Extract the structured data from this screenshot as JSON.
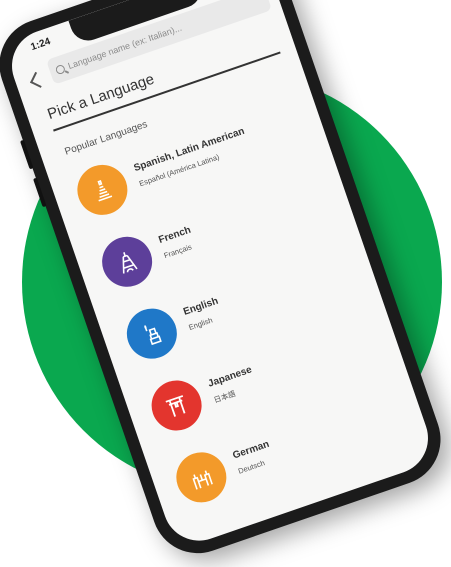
{
  "status_bar": {
    "time": "1:24",
    "icons": "▮▮▮ ◠ ▭"
  },
  "search": {
    "placeholder": "Language name (ex: Italian)..."
  },
  "page": {
    "title": "Pick a Language",
    "section_title": "Popular Languages"
  },
  "languages": [
    {
      "name": "Spanish, Latin American",
      "native": "Español (América Latina)",
      "color": "#f39a2a",
      "icon": "temple-icon"
    },
    {
      "name": "French",
      "native": "Français",
      "color": "#5d3f9a",
      "icon": "eiffel-tower-icon"
    },
    {
      "name": "English",
      "native": "English",
      "color": "#1f78c8",
      "icon": "statue-of-liberty-icon"
    },
    {
      "name": "Japanese",
      "native": "日本語",
      "color": "#e3352e",
      "icon": "torii-gate-icon"
    },
    {
      "name": "German",
      "native": "Deutsch",
      "color": "#f39a2a",
      "icon": "castle-icon"
    }
  ],
  "colors": {
    "background_circle": "#0aa84f",
    "phone_frame": "#1b1b1b",
    "screen": "#f7f7f6"
  }
}
